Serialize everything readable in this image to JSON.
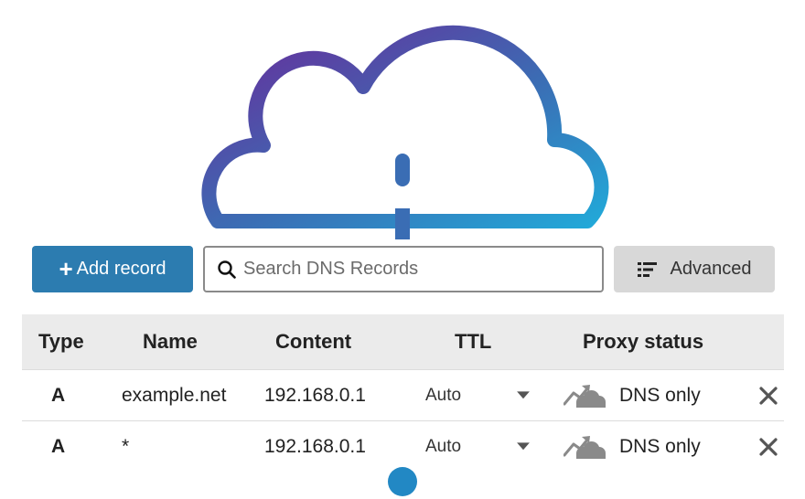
{
  "toolbar": {
    "add_label": "Add record",
    "search_placeholder": "Search DNS Records",
    "advanced_label": "Advanced"
  },
  "table": {
    "headers": {
      "type": "Type",
      "name": "Name",
      "content": "Content",
      "ttl": "TTL",
      "proxy": "Proxy status"
    },
    "rows": [
      {
        "type": "A",
        "name": "example.net",
        "content": "192.168.0.1",
        "ttl": "Auto",
        "proxy": "DNS only"
      },
      {
        "type": "A",
        "name": "*",
        "content": "192.168.0.1",
        "ttl": "Auto",
        "proxy": "DNS only"
      }
    ]
  },
  "slider": {
    "value_fraction": 0.5
  },
  "colors": {
    "primary_button": "#2c7cb0",
    "cloud_gradient_start": "#6a2a9a",
    "cloud_gradient_end": "#22a8d8",
    "slider_gradient_start": "#2e6fb5",
    "slider_gradient_end": "#00c8e0",
    "proxy_icon": "#888888"
  },
  "icons": {
    "cloud": "cloud-outline-icon",
    "add": "plus-icon",
    "search": "search-icon",
    "advanced": "list-filter-icon",
    "ttl_dropdown": "caret-down-icon",
    "proxy": "dns-only-cloud-icon",
    "delete": "close-icon"
  }
}
